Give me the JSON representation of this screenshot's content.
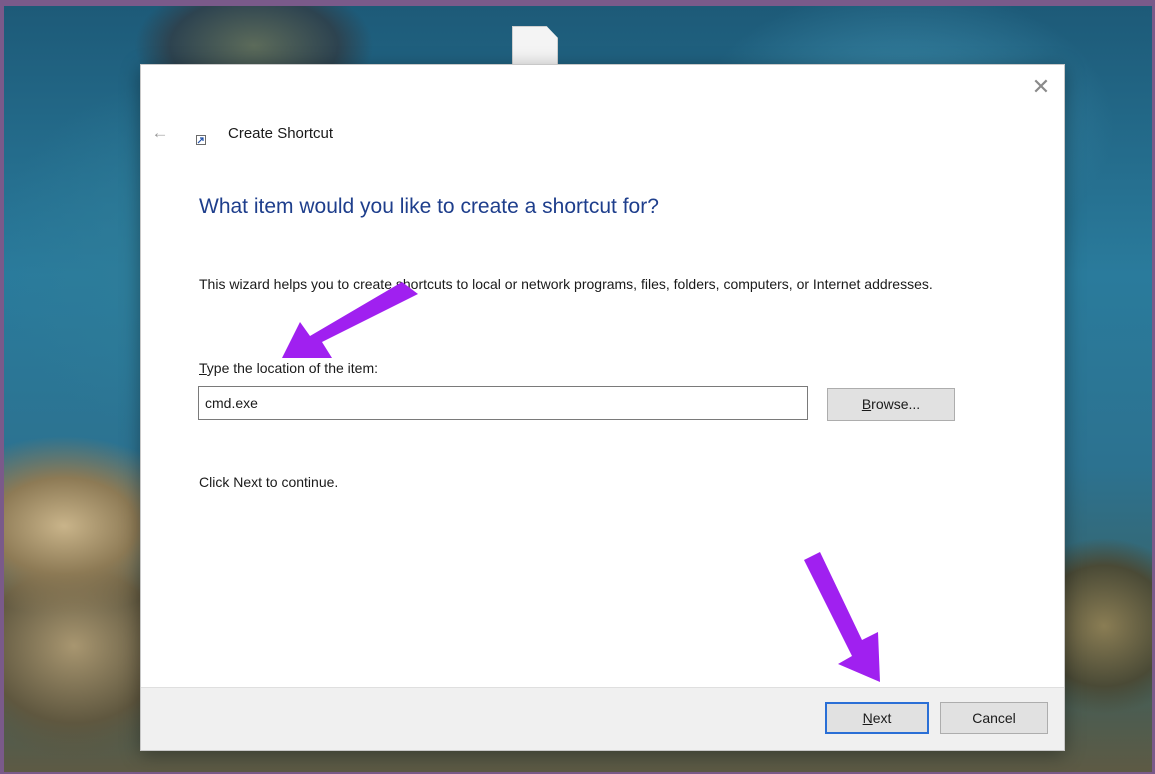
{
  "dialog": {
    "title": "Create Shortcut",
    "close_glyph": "✕",
    "back_glyph": "←",
    "heading": "What item would you like to create a shortcut for?",
    "description": "This wizard helps you to create shortcuts to local or network programs, files, folders, computers, or Internet addresses.",
    "field_label_first": "T",
    "field_label_rest": "ype the location of the item:",
    "location_value": "cmd.exe",
    "browse_first": "B",
    "browse_rest": "rowse...",
    "continue_text": "Click Next to continue.",
    "next_first": "N",
    "next_rest": "ext",
    "cancel_label": "Cancel"
  },
  "annotations": {
    "arrow_color": "#a020f0"
  },
  "colors": {
    "heading": "#1e3e8c",
    "default_button_border": "#2a6fd6"
  }
}
